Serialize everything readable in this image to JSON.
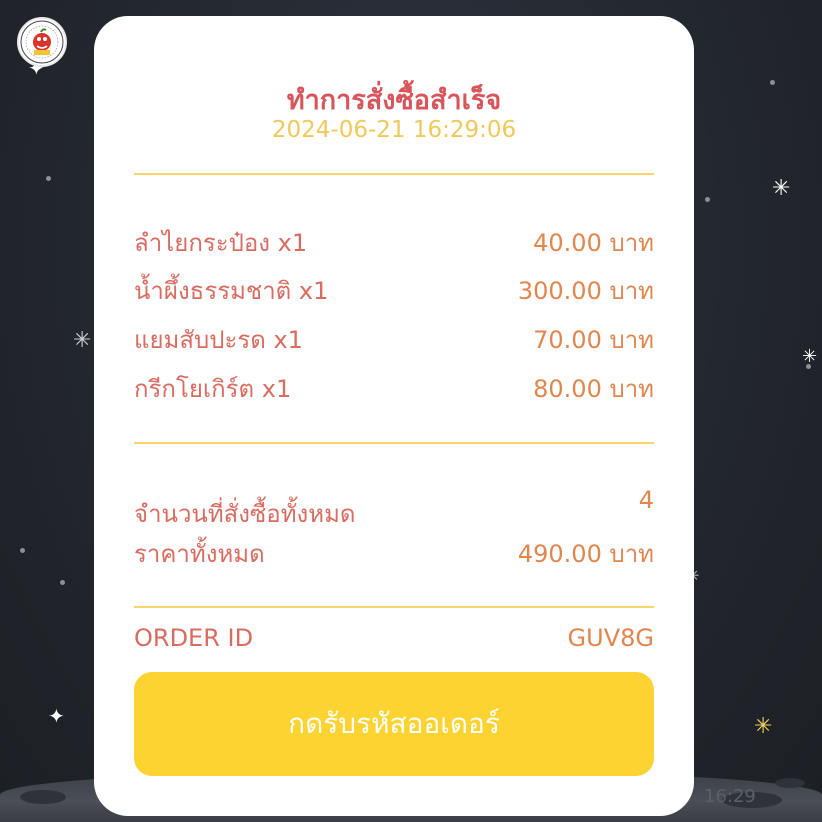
{
  "receipt": {
    "title": "ทำการสั่งซื้อสำเร็จ",
    "datetime": "2024-06-21 16:29:06",
    "items": [
      {
        "name": "ลำไยกระป๋อง x1",
        "price": "40.00 บาท"
      },
      {
        "name": "น้ำผึ้งธรรมชาติ x1",
        "price": "300.00 บาท"
      },
      {
        "name": "แยมสับปะรด x1",
        "price": "70.00 บาท"
      },
      {
        "name": "กรีกโยเกิร์ต x1",
        "price": "80.00 บาท"
      }
    ],
    "summary": {
      "count_label": "จำนวนที่สั่งซื้อทั้งหมด",
      "count_value": "4",
      "total_label": "ราคาทั้งหมด",
      "total_value": "490.00 บาท"
    },
    "order": {
      "id_label": "ORDER ID",
      "id_value": "GUV8G"
    },
    "button_label": "กดรับรหัสออเดอร์"
  },
  "chat": {
    "timestamp": "16:29"
  },
  "colors": {
    "title": "#d7555b",
    "datetime": "#f0c95a",
    "divider": "#f6d56e",
    "label": "#d96c61",
    "value": "#e0864f",
    "button": "#fcd330",
    "background": "#23272e"
  },
  "icons": {
    "avatar": "shop-logo-icon",
    "stars": "sparkle-star-icon"
  }
}
